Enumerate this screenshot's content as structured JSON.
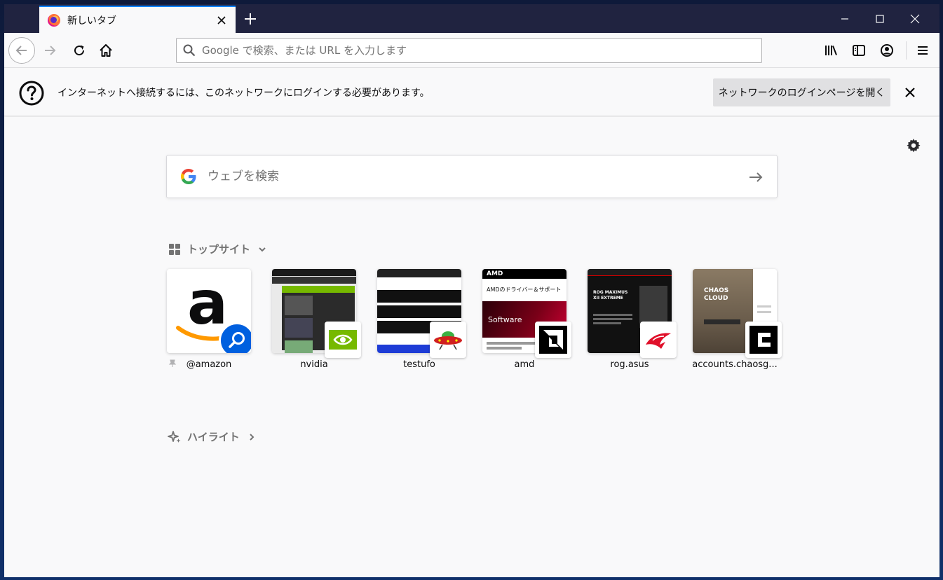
{
  "tab": {
    "title": "新しいタブ"
  },
  "urlbar": {
    "placeholder": "Google で検索、または URL を入力します"
  },
  "notification": {
    "message": "インターネットへ接続するには、このネットワークにログインする必要があります。",
    "button_label": "ネットワークのログインページを開く"
  },
  "newtab": {
    "search_placeholder": "ウェブを検索",
    "top_sites_heading": "トップサイト",
    "highlights_heading": "ハイライト",
    "top_sites": [
      {
        "label": "@amazon",
        "icon": "amazon-search-icon",
        "pinned": true
      },
      {
        "label": "nvidia",
        "icon": "nvidia-icon"
      },
      {
        "label": "testufo",
        "icon": "ufo-icon"
      },
      {
        "label": "amd",
        "icon": "amd-icon"
      },
      {
        "label": "rog.asus",
        "icon": "rog-icon"
      },
      {
        "label": "accounts.chaosg...",
        "icon": "chaos-icon"
      }
    ],
    "thumbs": {
      "amd_text": "AMDのドライバー＆サポート",
      "amd_brand": "AMD",
      "amd_product": "Software",
      "rog_headline": "ROG MAXIMUS XII EXTREME",
      "chaos_title": "CHAOS CLOUD"
    }
  },
  "colors": {
    "titlebar": "#202340",
    "accent": "#0a84ff",
    "toolbar": "#f9f9fa"
  }
}
